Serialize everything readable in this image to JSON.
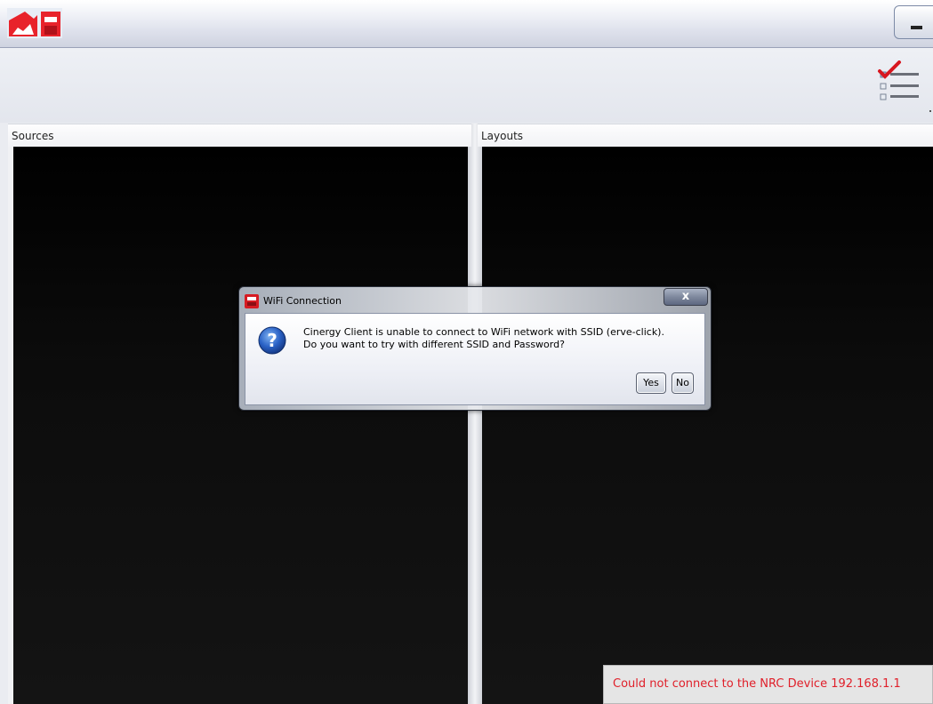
{
  "window": {
    "app_logo": "app-logo-icon",
    "minimize_icon": "minimize-icon"
  },
  "toolbar": {
    "checklist_icon": "checklist-icon"
  },
  "panels": {
    "sources": {
      "title": "Sources"
    },
    "layouts": {
      "title": "Layouts"
    }
  },
  "dialog": {
    "title": "WiFi Connection",
    "close_label": "x",
    "message": "Cinergy Client is unable to connect to WiFi network with SSID (erve-click). Do you want to try with different SSID and Password?",
    "yes_label": "Yes",
    "no_label": "No",
    "icon": "question-icon"
  },
  "status": {
    "message": "Could not connect to the NRC Device 192.168.1.1",
    "color": "#e0202a"
  }
}
